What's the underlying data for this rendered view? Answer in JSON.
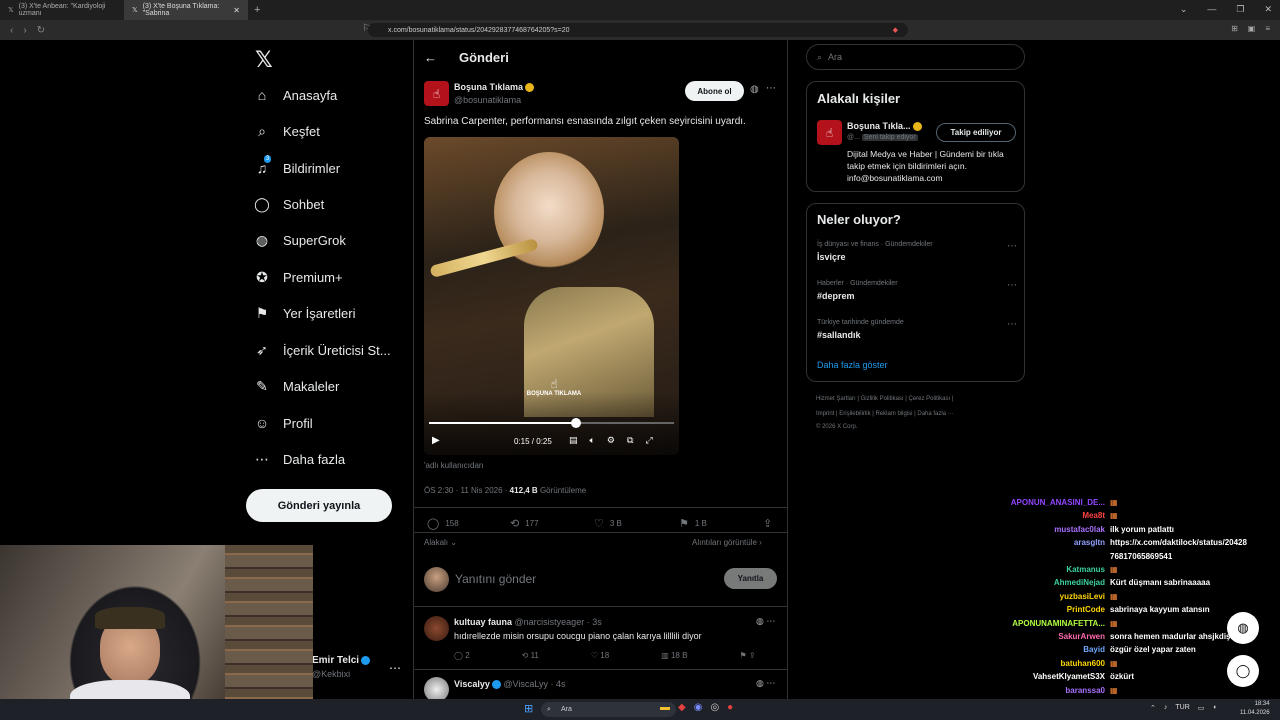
{
  "browser": {
    "tabs": [
      {
        "label": "(3) X'te Anbean: \"Kardiyoloji uzmanı"
      },
      {
        "label": "(3) X'te Boşuna Tıklama: \"Sabrina"
      }
    ],
    "url": "x.com/bosunatiklama/status/2042928377468764205?s=20"
  },
  "nav": {
    "logo": "𝕏",
    "items": [
      {
        "label": "Anasayfa",
        "icon": "home-icon",
        "glyph": "⌂"
      },
      {
        "label": "Keşfet",
        "icon": "search-icon",
        "glyph": "⌕"
      },
      {
        "label": "Bildirimler",
        "icon": "bell-icon",
        "glyph": "♫",
        "badge": "3"
      },
      {
        "label": "Sohbet",
        "icon": "chat-icon",
        "glyph": "◯"
      },
      {
        "label": "SuperGrok",
        "icon": "grok-icon",
        "glyph": "◍"
      },
      {
        "label": "Premium+",
        "icon": "premium-icon",
        "glyph": "✪"
      },
      {
        "label": "Yer İşaretleri",
        "icon": "bookmark-icon",
        "glyph": "⚑"
      },
      {
        "label": "İçerik Üreticisi St...",
        "icon": "rocket-icon",
        "glyph": "➶"
      },
      {
        "label": "Makaleler",
        "icon": "article-icon",
        "glyph": "✎"
      },
      {
        "label": "Profil",
        "icon": "profile-icon",
        "glyph": "☺"
      },
      {
        "label": "Daha fazla",
        "icon": "more-icon",
        "glyph": "⋯"
      }
    ],
    "post_button": "Gönderi yayınla",
    "account_name": "Emir Telci",
    "account_handle": "@Kekbixi"
  },
  "post": {
    "header": "Gönderi",
    "author_name": "Boşuna Tıklama",
    "author_handle": "@bosunatiklama",
    "subscribe_label": "Abone ol",
    "text": "Sabrina Carpenter, performansı esnasında zılgıt çeken seyircisini uyardı.",
    "video_watermark": "BOŞUNA TIKLAMA",
    "video_time": "0:15 / 0:25",
    "video_progress": 0.6,
    "from_user": "adlı kullanıcıdan",
    "time": "ÖS 2:30 · 11 Nis 2026 · ",
    "views": "412,4 B",
    "views_label": "Görüntüleme",
    "replies": "158",
    "reposts": "177",
    "likes": "3 B",
    "bookmarks": "1 B",
    "relevant_label": "Alakalı",
    "quotes_label": "Alıntıları görüntüle",
    "reply_placeholder": "Yanıtını gönder",
    "reply_button": "Yanıtla"
  },
  "replies": [
    {
      "name": "kultuay fauna",
      "handle": "@narcisistyeager · 3s",
      "text": "hıdırellezde misin orsupu coucgu piano çalan karıya lilllili diyor",
      "replies": "2",
      "reposts": "11",
      "likes": "18",
      "views": "18 B"
    },
    {
      "name": "Viscalyy",
      "handle": "@ViscaLyy · 4s"
    }
  ],
  "right": {
    "search_placeholder": "Ara",
    "related_title": "Alakalı kişiler",
    "related_name": "Boşuna Tıkla...",
    "related_handle": "@...",
    "follows_you": "Seni takip ediyor",
    "following_button": "Takip ediliyor",
    "related_bio": "Dijital Medya ve Haber | Gündemi bir tıkla takip etmek için bildirimleri açın. info@bosunatiklama.com",
    "trends_title": "Neler oluyor?",
    "trends": [
      {
        "meta": "İş dünyası ve finans · Gündemdekiler",
        "name": "İsviçre"
      },
      {
        "meta": "Haberler · Gündemdekiler",
        "name": "#deprem"
      },
      {
        "meta": "Türkiye tarihinde gündemde",
        "name": "#sallandık"
      }
    ],
    "show_more": "Daha fazla göster",
    "footer1": "Hizmet Şartları  |  Gizlilik Politikası  |  Çerez Politikası  |",
    "footer2": "Imprint  |  Erişilebilirlik  |  Reklam bilgisi  |  Daha fazla ···",
    "footer3": "© 2026 X Corp."
  },
  "chat": [
    {
      "user": "APONUN_ANASINI_DE...",
      "msg": "",
      "color": "#9146ff"
    },
    {
      "user": "Mea8t",
      "msg": "",
      "color": "#ff4444"
    },
    {
      "user": "mustafac0lak",
      "msg": "ilk yorum patlattı",
      "color": "#a970ff"
    },
    {
      "user": "arasgltn",
      "msg": "https://x.com/daktilock/status/20428",
      "color": "#8fa0ff"
    },
    {
      "user": "",
      "msg": "76817065869541",
      "color": "#8fa0ff"
    },
    {
      "user": "Katmanus",
      "msg": "",
      "color": "#3bd3a0"
    },
    {
      "user": "AhmediNejad",
      "msg": "Kürt düşmanı sabrinaaaaa",
      "color": "#3bd3a0"
    },
    {
      "user": "yuzbasiLevi",
      "msg": "",
      "color": "#ffd700"
    },
    {
      "user": "PrintCode",
      "msg": "sabrinaya kayyum atansın",
      "color": "#ffd700"
    },
    {
      "user": "APONUNAMINAFETTA...",
      "msg": "",
      "color": "#b0ff40"
    },
    {
      "user": "SakurArwen",
      "msg": "sonra hemen madurlar ahsjkdişfigh",
      "color": "#ff6ab0"
    },
    {
      "user": "Bayid",
      "msg": "özgür özel yapar zaten",
      "color": "#6fa8ff"
    },
    {
      "user": "batuhan600",
      "msg": "",
      "color": "#ffd700"
    },
    {
      "user": "VahsetKlyametS3X",
      "msg": "özkürt",
      "color": "#ffffff"
    },
    {
      "user": "baranssa0",
      "msg": "",
      "color": "#a970ff"
    }
  ],
  "taskbar": {
    "search": "Ara",
    "lang": "TUR",
    "time": "18:34",
    "date": "11.04.2026"
  }
}
